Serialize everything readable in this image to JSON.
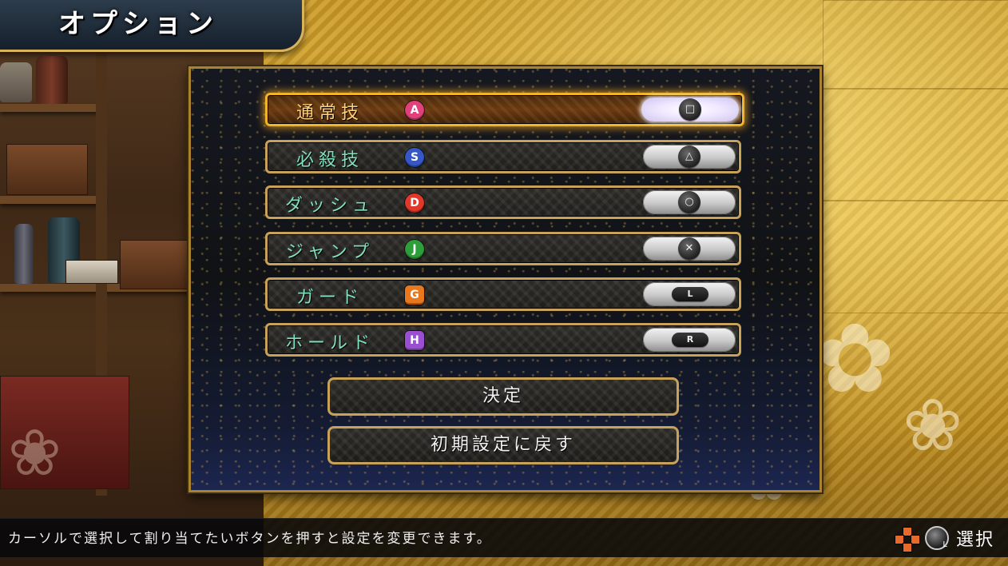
{
  "title": "オプション",
  "assignments": [
    {
      "label": "通常技",
      "action_letter": "A",
      "action_color": "#e0417a",
      "button_symbol": "□",
      "button_icon": "square-button-icon",
      "selected": true
    },
    {
      "label": "必殺技",
      "action_letter": "S",
      "action_color": "#3557c8",
      "button_symbol": "△",
      "button_icon": "triangle-button-icon",
      "selected": false
    },
    {
      "label": "ダッシュ",
      "action_letter": "D",
      "action_color": "#e2382c",
      "button_symbol": "○",
      "button_icon": "circle-button-icon",
      "selected": false
    },
    {
      "label": "ジャンプ",
      "action_letter": "J",
      "action_color": "#2e9e3a",
      "button_symbol": "✕",
      "button_icon": "cross-button-icon",
      "selected": false
    },
    {
      "label": "ガード",
      "action_letter": "G",
      "action_color": "#e8781e",
      "button_symbol": "L",
      "button_icon": "l-shoulder-button-icon",
      "selected": false
    },
    {
      "label": "ホールド",
      "action_letter": "H",
      "action_color": "#9a4fd0",
      "button_symbol": "R",
      "button_icon": "r-shoulder-button-icon",
      "selected": false
    }
  ],
  "buttons": {
    "confirm": "決定",
    "reset": "初期設定に戻す"
  },
  "help": {
    "text": "カーソルで選択して割り当てたいボタンを押すと設定を変更できます。",
    "select_label": "選択",
    "stick_letter": "L"
  }
}
